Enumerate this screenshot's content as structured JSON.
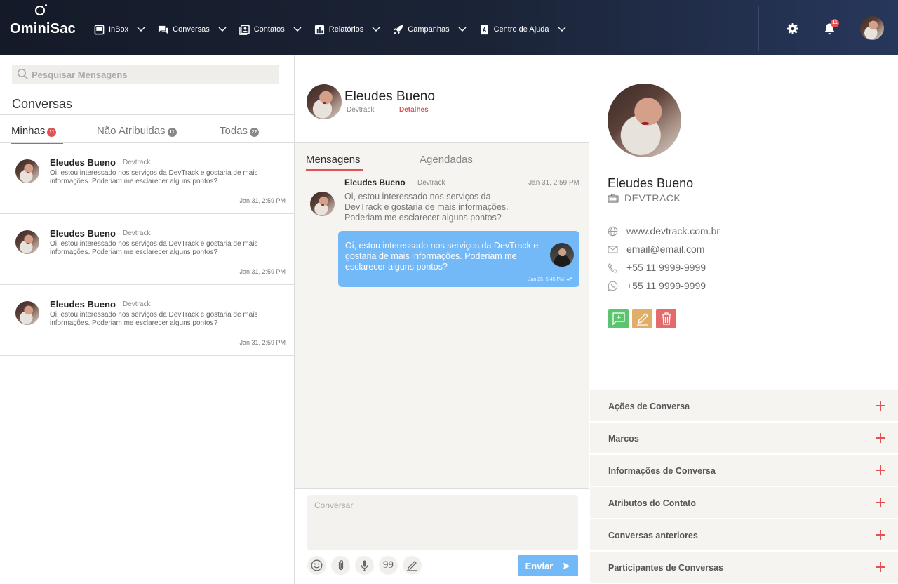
{
  "app": {
    "logo_text": "OminiSac",
    "notification_count": "11"
  },
  "nav": {
    "items": [
      {
        "label": "InBox",
        "icon": "inbox-icon"
      },
      {
        "label": "Conversas",
        "icon": "chat-icon"
      },
      {
        "label": "Contatos",
        "icon": "contacts-icon"
      },
      {
        "label": "Relatórios",
        "icon": "chart-icon"
      },
      {
        "label": "Campanhas",
        "icon": "rocket-icon"
      },
      {
        "label": "Centro de Ajuda",
        "icon": "help-book-icon"
      }
    ]
  },
  "left": {
    "search_placeholder": "Pesquisar Mensagens",
    "title": "Conversas",
    "tabs": [
      {
        "label": "Minhas",
        "count": "11",
        "badge_color": "#e05254"
      },
      {
        "label": "Não Atribuidas",
        "count": "11",
        "badge_color": "#888888"
      },
      {
        "label": "Todas",
        "count": "22",
        "badge_color": "#888888"
      }
    ],
    "conversations": [
      {
        "name": "Eleudes Bueno",
        "company": "Devtrack",
        "message": "Oi, estou interessado nos serviços da DevTrack e gostaria de mais informações. Poderiam me esclarecer alguns pontos?",
        "time": "Jan 31, 2:59 PM"
      },
      {
        "name": "Eleudes Bueno",
        "company": "Devtrack",
        "message": "Oi, estou interessado nos serviços da DevTrack e gostaria de mais informações. Poderiam me esclarecer alguns pontos?",
        "time": "Jan 31, 2:59 PM"
      },
      {
        "name": "Eleudes Bueno",
        "company": "Devtrack",
        "message": "Oi, estou interessado nos serviços da DevTrack e gostaria de mais informações. Poderiam me esclarecer alguns pontos?",
        "time": "Jan 31, 2:59 PM"
      }
    ]
  },
  "chat": {
    "header": {
      "name": "Eleudes Bueno",
      "company": "Devtrack",
      "details_label": "Detalhes"
    },
    "tabs": [
      "Mensagens",
      "Agendadas"
    ],
    "incoming": {
      "name": "Eleudes Bueno",
      "company": "Devtrack",
      "time": "Jan 31, 2:59 PM",
      "text": "Oi, estou interessado nos serviços da DevTrack e gostaria de mais informações. Poderiam me esclarecer alguns pontos?"
    },
    "outgoing": {
      "text": "Oi, estou interessado nos serviços da DevTrack e gostaria de mais informações. Poderiam me esclarecer alguns pontos?",
      "time": "Jan 25, 5:45 PM"
    },
    "composer_placeholder": "Conversar",
    "send_label": "Enviar",
    "tools": [
      "emoji-icon",
      "attach-icon",
      "mic-icon",
      "quote-icon",
      "pen-icon"
    ],
    "quote_glyph": "99"
  },
  "contact": {
    "name": "Eleudes Bueno",
    "company": "DEVTRACK",
    "website": "www.devtrack.com.br",
    "email": "email@email.com",
    "phone": "+55 11 9999-9999",
    "whatsapp": "+55 11 9999-9999",
    "action_colors": {
      "new": "#5cc46f",
      "edit": "#e1ae6a",
      "delete": "#e36b6b"
    },
    "sections": [
      "Ações de Conversa",
      "Marcos",
      "Informações de Conversa",
      "Atributos do Contato",
      "Conversas anteriores",
      "Participantes de Conversas"
    ]
  }
}
